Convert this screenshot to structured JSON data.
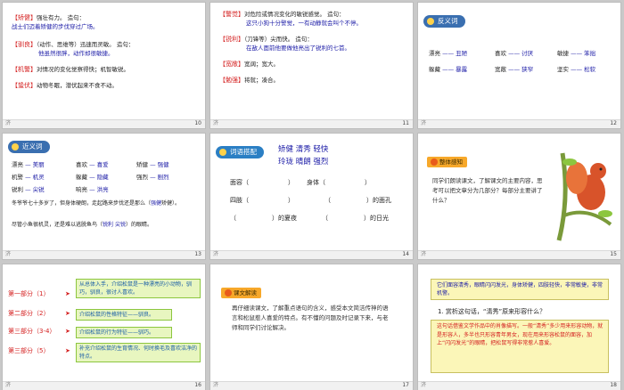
{
  "slides": [
    {
      "page": "10",
      "rows": [
        {
          "tag": "【矫健】",
          "text": "强壮有力。 造句：",
          "example": "战士们迈着矫健的步伐穿过广场。"
        },
        {
          "tag": "【驯良】",
          "text": "（动作、思维等）迅速而灵敏。 造句：",
          "example": "他虽然很胖，动作却很敏捷。"
        },
        {
          "tag": "【机警】",
          "text": "对情况的变化觉察得快；机智敏锐。",
          "example": ""
        },
        {
          "tag": "【蛰伏】",
          "text": "动物冬眠，潜伏起来不食不动。",
          "example": ""
        }
      ]
    },
    {
      "page": "11",
      "rows": [
        {
          "tag": "【警觉】",
          "text": "对危险或情况变化的敏锐感觉。 造句：",
          "example": "这只小狗十分警觉，一有动静就会叫个不停。"
        },
        {
          "tag": "【锐利】",
          "text": "（刀锋等）尖而快。 造句：",
          "example": "在敌人面前他要做他亮出了锐利的七首。"
        },
        {
          "tag": "【宽敞】",
          "text": "宽阔；宽大。",
          "example": ""
        },
        {
          "tag": "【勉强】",
          "text": "将就；凑合。",
          "example": ""
        }
      ]
    },
    {
      "page": "12",
      "heading": "反义词",
      "pairs": [
        {
          "a": "漂亮",
          "b": "丑陋"
        },
        {
          "a": "喜欢",
          "b": "讨厌"
        },
        {
          "a": "敏捷",
          "b": "笨拙"
        },
        {
          "a": "躲藏",
          "b": "暴露"
        },
        {
          "a": "宽敞",
          "b": "狭窄"
        },
        {
          "a": "坚实",
          "b": "松软"
        }
      ]
    },
    {
      "page": "13",
      "heading": "近义词",
      "pairs": [
        {
          "a": "漂亮",
          "b": "美丽"
        },
        {
          "a": "喜欢",
          "b": "喜爱"
        },
        {
          "a": "矫健",
          "b": "强健"
        },
        {
          "a": "机警",
          "b": "机灵"
        },
        {
          "a": "躲藏",
          "b": "隐藏"
        },
        {
          "a": "强烈",
          "b": "剧烈"
        },
        {
          "a": "锐利",
          "b": "尖锐"
        },
        {
          "a": "响亮",
          "b": "洪亮"
        }
      ],
      "sentence1": "冬爷爷七十多岁了，但身体硬朗，走起路来步伐还是那么（",
      "sentence1_answer": "强健",
      "sentence1_end": "矫健）。",
      "sentence2": "尽管小鱼很机灵，还是难以逃脱鱼鸟（",
      "sentence2_a1": "锐利",
      "sentence2_a2": "尖锐",
      "sentence2_end": "）的眼睛。"
    },
    {
      "page": "14",
      "heading": "词语搭配",
      "words_line1": "矫健  清秀  轻快",
      "words_line2": "玲珑  晴朗  强烈",
      "lines": [
        {
          "a": "面容（",
          "b": "）",
          "c": "身体（",
          "d": "）"
        },
        {
          "a": "四肢（",
          "b": "）",
          "c": "（",
          "d": "）的面孔"
        },
        {
          "a": "（",
          "b": "）的夏夜",
          "c": "（",
          "d": "）的日光"
        }
      ]
    },
    {
      "page": "15",
      "heading": "整体感知",
      "text": "同学们朗读课文，了解课文的主要内容，思考可以把文章分为几部分？每部分主要讲了什么？"
    },
    {
      "page": "16",
      "parts": [
        {
          "label": "第一部分（1）",
          "summary": "从总体入手，介绍松鼠是一种漂亮的小动物，驯巧，驯良，很讨人喜欢。"
        },
        {
          "label": "第二部分（2）",
          "summary": "介绍松鼠的性格特征——驯良。"
        },
        {
          "label": "第三部分（3-4）",
          "summary": "介绍松鼠的行为特征——驯巧。"
        },
        {
          "label": "第三部分（5）",
          "summary": "补充介绍松鼠的生育情况、何时换毛及喜欢洁净的特点。"
        }
      ]
    },
    {
      "page": "17",
      "heading": "课文解读",
      "text": "再仔细读课文，了解重点语句的含义，感受本文简洁传神的语言和松鼠惹人喜爱的特点。有不懂的问题及时记录下来，与老师和同学们讨论解决。"
    },
    {
      "page": "18",
      "quote": "它们面容清秀，眼睛闪闪发光，身体矫健，四肢轻快，非常敏捷，非常机警。",
      "question": "1. 赏析这句话，“清秀”原来形容什么？",
      "answer": "这句话借鉴文学作品中的肖像描写。一般“清秀”多少用来形容动物，就是形容人，多半也只形容青年男女，现在用来形容松鼠的面容，加上“闪闪发光”的眼睛，把松鼠写得非常惹人喜爱。"
    }
  ],
  "footer_logo": "济"
}
